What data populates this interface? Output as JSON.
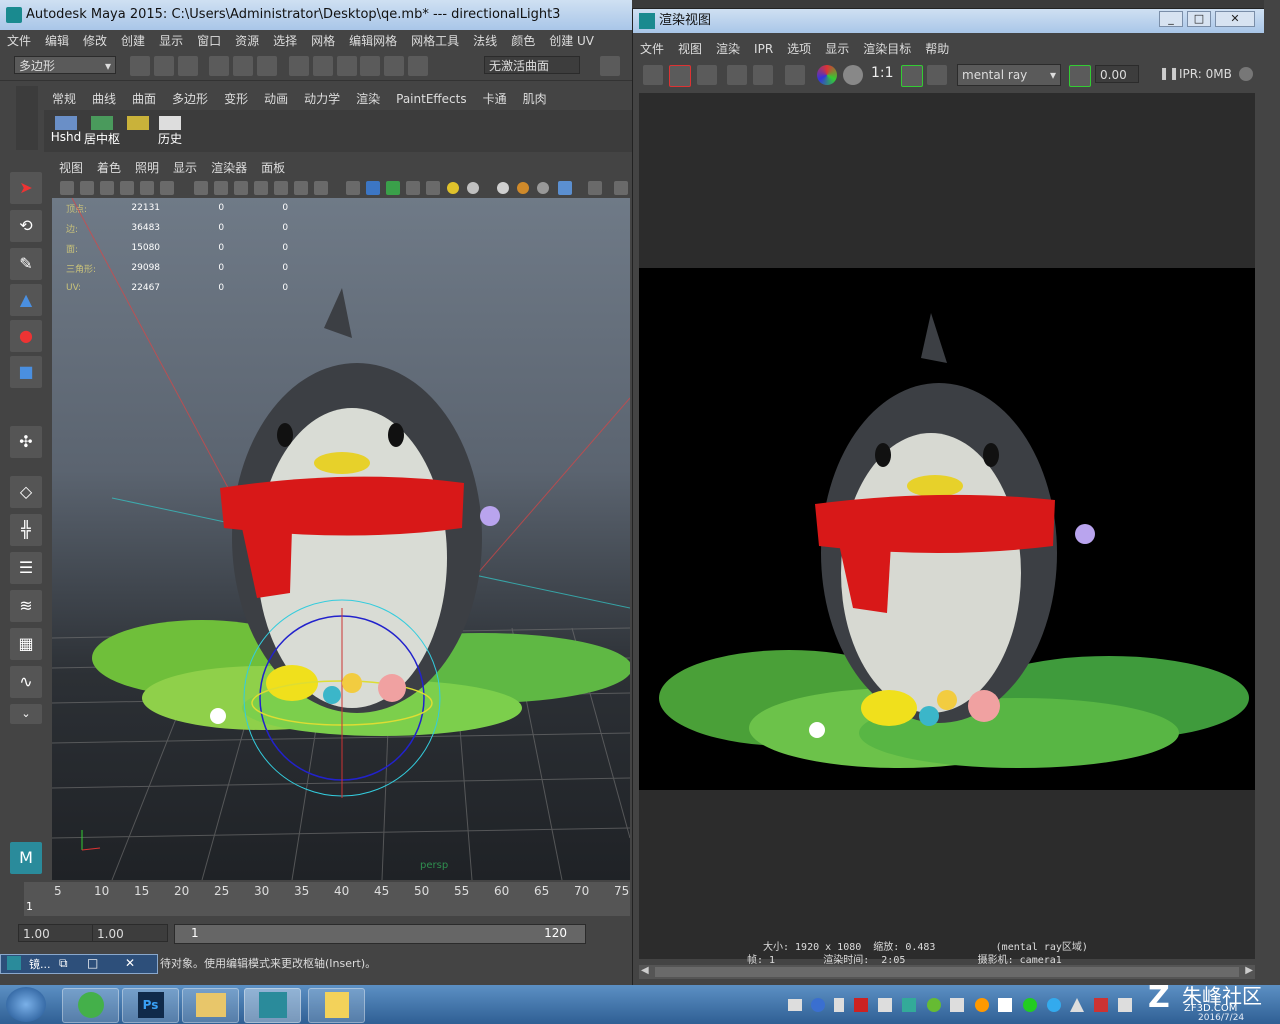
{
  "maya": {
    "title": "Autodesk Maya 2015: C:\\Users\\Administrator\\Desktop\\qe.mb*   ---   directionalLight3",
    "menu": [
      "文件",
      "编辑",
      "修改",
      "创建",
      "显示",
      "窗口",
      "资源",
      "选择",
      "网格",
      "编辑网格",
      "网格工具",
      "法线",
      "颜色",
      "创建 UV"
    ],
    "mode_dropdown": "多边形",
    "toolbar_field": "无激活曲面",
    "shelf_tabs": [
      "常规",
      "曲线",
      "曲面",
      "多边形",
      "变形",
      "动画",
      "动力学",
      "渲染",
      "PaintEffects",
      "卡通",
      "肌肉"
    ],
    "shelf_buttons": [
      "Hshd",
      "居中枢",
      "历史"
    ],
    "viewport_menu": [
      "视图",
      "着色",
      "照明",
      "显示",
      "渲染器",
      "面板"
    ],
    "hud": {
      "rows": [
        {
          "label": "顶点:",
          "a": "22131",
          "b": "0",
          "c": "0"
        },
        {
          "label": "边:",
          "a": "36483",
          "b": "0",
          "c": "0"
        },
        {
          "label": "面:",
          "a": "15080",
          "b": "0",
          "c": "0"
        },
        {
          "label": "三角形:",
          "a": "29098",
          "b": "0",
          "c": "0"
        },
        {
          "label": "UV:",
          "a": "22467",
          "b": "0",
          "c": "0"
        }
      ]
    },
    "camera_label": "persp",
    "timeline_ticks": [
      "5",
      "10",
      "15",
      "20",
      "25",
      "30",
      "35",
      "40",
      "45",
      "50",
      "55",
      "60",
      "65",
      "70",
      "75"
    ],
    "current_frame": "1",
    "range_start": "1.00",
    "range_start2": "1.00",
    "range_inner_start": "1",
    "range_inner_end": "120",
    "status_text": "待对象。使用编辑模式来更改枢轴(Insert)。",
    "mini_window_label": "镜..."
  },
  "render_view": {
    "title": "渲染视图",
    "menu": [
      "文件",
      "视图",
      "渲染",
      "IPR",
      "选项",
      "显示",
      "渲染目标",
      "帮助"
    ],
    "ratio_label": "1:1",
    "renderer": "mental ray",
    "exposure": "0.00",
    "ipr_label": "IPR: 0MB",
    "info_line1": "大小: 1920 x 1080  缩放: 0.483          (mental ray区域)",
    "info_line2": "帧: 1        渲染时间:  2:05            摄影机: camera1"
  },
  "taskbar": {
    "apps": [
      "ie",
      "photoshop",
      "explorer",
      "maya",
      "notepad"
    ],
    "ps_label": "Ps",
    "clock_date": "2016/7/24",
    "watermark": "朱峰社区",
    "watermark_sub": "ZF3D.COM"
  },
  "colors": {
    "title_bar": "#a9c6e8",
    "maya_bg": "#444444",
    "render_bg": "#000000",
    "scarf": "#d81818",
    "penguin_body": "#3c3f44",
    "belly": "#d9dcd5",
    "beak": "#e7d12a",
    "grass": "#5fb844"
  }
}
